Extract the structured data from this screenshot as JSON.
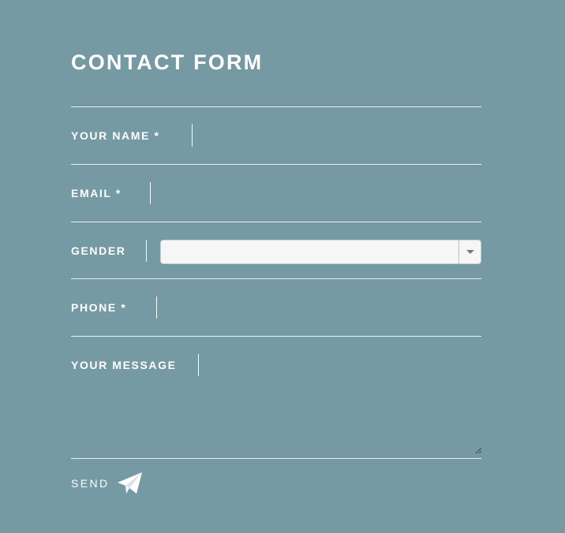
{
  "form": {
    "title": "CONTACT FORM",
    "background_color": "#759aa3",
    "text_color": "#ffffff",
    "fields": {
      "name": {
        "label": "YOUR NAME *",
        "value": ""
      },
      "email": {
        "label": "EMAIL *",
        "value": ""
      },
      "gender": {
        "label": "GENDER",
        "selected": ""
      },
      "phone": {
        "label": "PHONE *",
        "value": ""
      },
      "message": {
        "label": "YOUR MESSAGE",
        "value": ""
      }
    },
    "send": {
      "label": "SEND",
      "icon": "paper-plane-icon"
    },
    "select_icon": "chevron-down-icon",
    "resize_icon": "resize-grip-icon"
  }
}
